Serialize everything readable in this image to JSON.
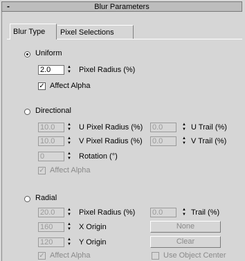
{
  "rollout": {
    "collapse_symbol": "-",
    "title": "Blur Parameters"
  },
  "tabs": [
    {
      "label": "Blur Type"
    },
    {
      "label": "Pixel Selections"
    }
  ],
  "uniform": {
    "label": "Uniform",
    "pixel_radius": {
      "value": "2.0",
      "label": "Pixel Radius (%)"
    },
    "affect_alpha": {
      "label": "Affect Alpha",
      "checked": "✓"
    }
  },
  "directional": {
    "label": "Directional",
    "u_radius": {
      "value": "10.0",
      "label": "U Pixel Radius (%)"
    },
    "u_trail": {
      "value": "0.0",
      "label": "U Trail (%)"
    },
    "v_radius": {
      "value": "10.0",
      "label": "V Pixel Radius (%)"
    },
    "v_trail": {
      "value": "0.0",
      "label": "V Trail (%)"
    },
    "rotation": {
      "value": "0",
      "label": "Rotation (°)"
    },
    "affect_alpha": {
      "label": "Affect Alpha",
      "checked": "✓"
    }
  },
  "radial": {
    "label": "Radial",
    "pixel_radius": {
      "value": "20.0",
      "label": "Pixel Radius (%)"
    },
    "trail": {
      "value": "0.0",
      "label": "Trail (%)"
    },
    "x_origin": {
      "value": "160",
      "label": "X Origin"
    },
    "y_origin": {
      "value": "120",
      "label": "Y Origin"
    },
    "none_button": "None",
    "clear_button": "Clear",
    "affect_alpha": {
      "label": "Affect Alpha",
      "checked": "✓"
    },
    "use_object_center": {
      "label": "Use Object Center"
    }
  },
  "spinner_glyphs": {
    "up": "▲",
    "down": "▼"
  }
}
